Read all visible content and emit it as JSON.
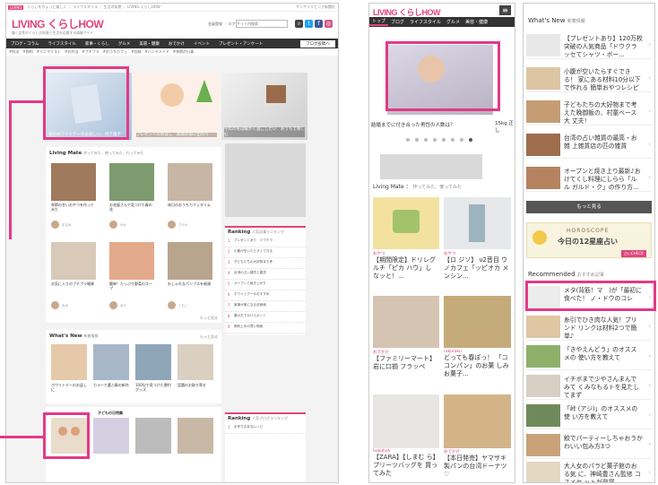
{
  "desktop": {
    "top_strip": {
      "badge": "LIVING",
      "text": "くらしをちょっと楽しく ｜ ライフスタイル ｜ 生活の知恵 ｜ LIVING くらしHOW",
      "right": "サンケイリビング新聞社"
    },
    "logo": "LIVING くらしHOW",
    "tagline": "働く女性のくらしの知恵と生活を応援する情報サイト",
    "header_links": "会員登録 ｜ ログイン",
    "search_placeholder": "サイト内検索",
    "nav": [
      "ブログ・コラム",
      "ライフスタイル",
      "家事・くらし",
      "グルメ",
      "美容・健康",
      "おでかけ",
      "イベント",
      "プレゼント・アンケート"
    ],
    "nav_button": "ブログ投稿へ",
    "subnav": "#防災　#節約　#ミニマリスト　#お弁当　#プチプラ　#おうちカフェ　#収納　#ハンドメイド　#季節の行事",
    "hero": [
      {
        "caption": "冬のホワイトデーのお返しに、焼き菓子"
      },
      {
        "caption": "プレゼントのお返し　家族の思い出作り"
      },
      {
        "caption": "今年の冬は暖かく過ごしたい　おうちで楽しむ"
      }
    ],
    "living_mate": {
      "title": "Living Mate",
      "sub": "作ってみた、使ってみた、行ってみた"
    },
    "mate_posts": [
      {
        "title": "季節の甘いおやつを作ってみた",
        "author": "まなみ"
      },
      {
        "title": "お花屋さんで見つけた春の花",
        "author": "ゆか"
      },
      {
        "title": "休日のおうちカフェタイム",
        "author": "さやか"
      },
      {
        "title": "お気に入りのプチプラ雑貨",
        "author": "みほ"
      },
      {
        "title": "簡単！たっぷり野菜のスープ",
        "author": "あや"
      },
      {
        "title": "おしゃれなパンプスを新調",
        "author": "ともこ"
      }
    ],
    "more": "もっと見る",
    "ranking": {
      "title": "Ranking",
      "sub": "人気記事ランキング",
      "items": [
        "プレゼントあり　ドウクラ",
        "小腹が空いたらすぐできる",
        "子どもたちの大好物まで考",
        "台湾の占い雑貨と雑貨",
        "オープンと焼き上がり",
        "ホワイトデーのおすすめ",
        "家事が楽になる収納術",
        "春のおでかけスポット",
        "節約上手の買い物術",
        "手作りお弁当レシピ"
      ]
    },
    "whats_new": {
      "title": "What's New",
      "sub": "新着情報",
      "more": "もっと見る"
    },
    "new_posts": [
      "ホワイトデーのお返しに",
      "カラーで選ぶ春の新作",
      "100均で見つけた便利グッズ",
      "話題のお取り寄せ"
    ],
    "kids_section": "子どもの日特集",
    "ranking2": {
      "title": "Ranking",
      "sub": "人気ブログランキング"
    }
  },
  "mobile1": {
    "logo": "LIVING くらしHOW",
    "tabs": [
      "トップ",
      "ブログ",
      "ライフスタイル",
      "グルメ",
      "美容・健康"
    ],
    "slider_caption": "結婚までに付き合った男性の人数は？",
    "slider_caption_right": "15kg 正し",
    "living_mate": {
      "title": "Living Mate",
      "sub": "作ってみた、使ってみた"
    },
    "cards": [
      {
        "cat": "おやつ",
        "title": "【期間限定】ドリレグ ルチ「ピカ ハウ」し なッと！..."
      },
      {
        "cat": "おやつ",
        "title": "【ロ ジソ】 ν2音目 ウノカフェ「ッピオカ メンシン..."
      },
      {
        "cat": "おでかけ",
        "title": "【ファミリーマート】 岩に口揃 フラッペ"
      },
      {
        "cat": "rakuraku",
        "title": "どっても春ぽっ！ 「ココンパン」のお菓 しみお菓子..."
      },
      {
        "cat": "hokuhoh",
        "title": "【ZARA】【しまむ ら】 プリーツバッグを 買ってみた"
      },
      {
        "cat": "おでかけ",
        "title": "【本日発売】ヤマザキ 製パンの台湾ドーナツ ♡"
      }
    ]
  },
  "mobile2": {
    "whats_new": {
      "title": "What's New",
      "sub": "新着情報"
    },
    "new_items": [
      "【プレゼントあり】120万枚 突破の人気商品「ドウクラ ッセてシャツ・ボー...",
      "小腹が空いたらすぐできる！ 家にある材料10分以下で作れる 簡単おやつレシピ",
      "子どもたちの大好物まで考 えた晩御飯の、村童ベース大 丈夫！",
      "台湾の占い雑貨の最高・お雑 上雑貨店の匹の雑貨",
      "オープンと焼き上り最新♪お けてくし料理にしらら「ルル ガルド・ク」の作り方..."
    ],
    "more_button": "もっと見る",
    "horoscope": {
      "label": "HOROSCOPE",
      "text": "今日の12星座占い",
      "tag": "占いCHECK"
    },
    "recommended": {
      "title": "Recommended",
      "sub": "おすすめ記事"
    },
    "rec_items": [
      "メタ(背筋！マ　)が「最初に 食べた！ ノ・ドウのコレ",
      "糸引でひき肉な人気！プリンド リンクは材料2つで簡単♪",
      "「きやえんどう」のオススメの 使い方を教えて",
      "イチボまで少やさんまんでみて くみなもるトを見たしてまず",
      "「峠 (アジ)」のオススメの使 い方を教えて",
      "鮫でパーティーしちゃおうか わいい包み方3つ",
      "大人女のパラど菓子館のおる気 に、神崎豊さん監修 コスメセ ットが登場"
    ]
  },
  "colors": {
    "accent": "#e0457b",
    "highlight": "#e23a87",
    "nav": "#333333"
  }
}
